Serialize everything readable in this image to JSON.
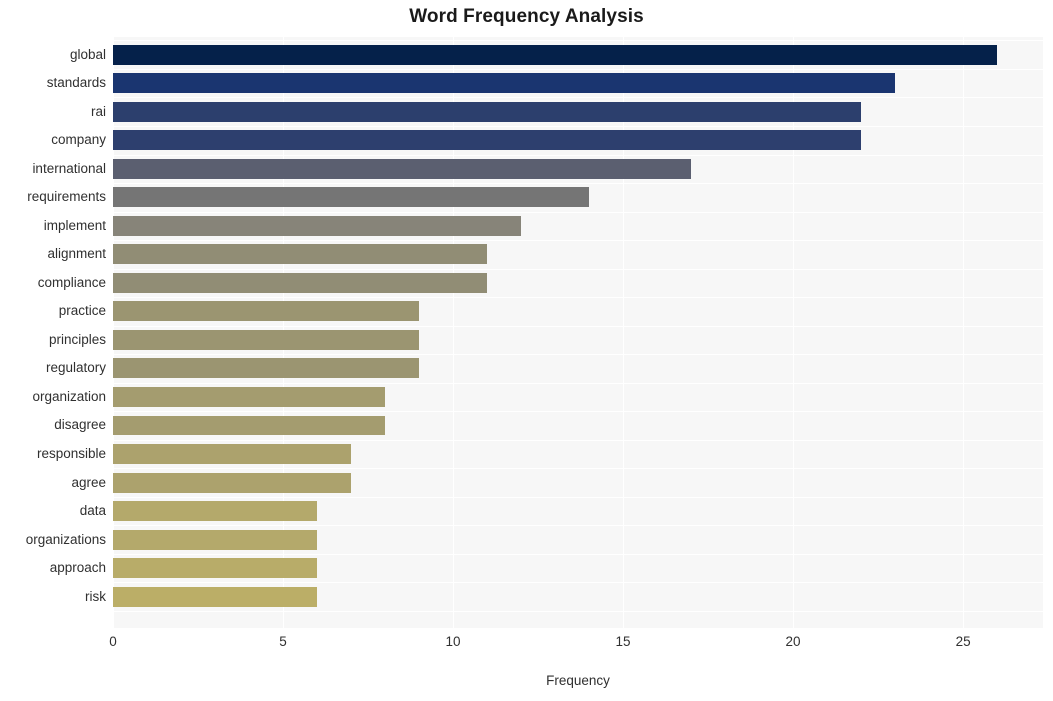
{
  "chart_data": {
    "type": "bar",
    "orientation": "horizontal",
    "title": "Word Frequency Analysis",
    "xlabel": "Frequency",
    "ylabel": "",
    "xlim": [
      0,
      27.35
    ],
    "xticks": [
      0,
      5,
      10,
      15,
      20,
      25
    ],
    "xtick_labels": [
      "0",
      "5",
      "10",
      "15",
      "20",
      "25"
    ],
    "grid": true,
    "grid_axis": "both",
    "legend": null,
    "plot_background": "#f7f7f7",
    "figure_background": "#ffffff",
    "categories": [
      "global",
      "standards",
      "rai",
      "company",
      "international",
      "requirements",
      "implement",
      "alignment",
      "compliance",
      "practice",
      "principles",
      "regulatory",
      "organization",
      "disagree",
      "responsible",
      "agree",
      "data",
      "organizations",
      "approach",
      "risk"
    ],
    "values": [
      26,
      23,
      22,
      22,
      17,
      14,
      12,
      11,
      11,
      9,
      9,
      9,
      8,
      8,
      7,
      7,
      6,
      6,
      6,
      6
    ],
    "bar_colors": [
      "#05214a",
      "#1a3570",
      "#2c3f6d",
      "#2d3f6e",
      "#5b5f70",
      "#757575",
      "#878479",
      "#918d75",
      "#918d75",
      "#9b9571",
      "#9b9571",
      "#9b9571",
      "#a49c6f",
      "#a49c6f",
      "#aca26d",
      "#aca26d",
      "#b4a96b",
      "#b4a96b",
      "#b8ac69",
      "#bbae67"
    ]
  }
}
